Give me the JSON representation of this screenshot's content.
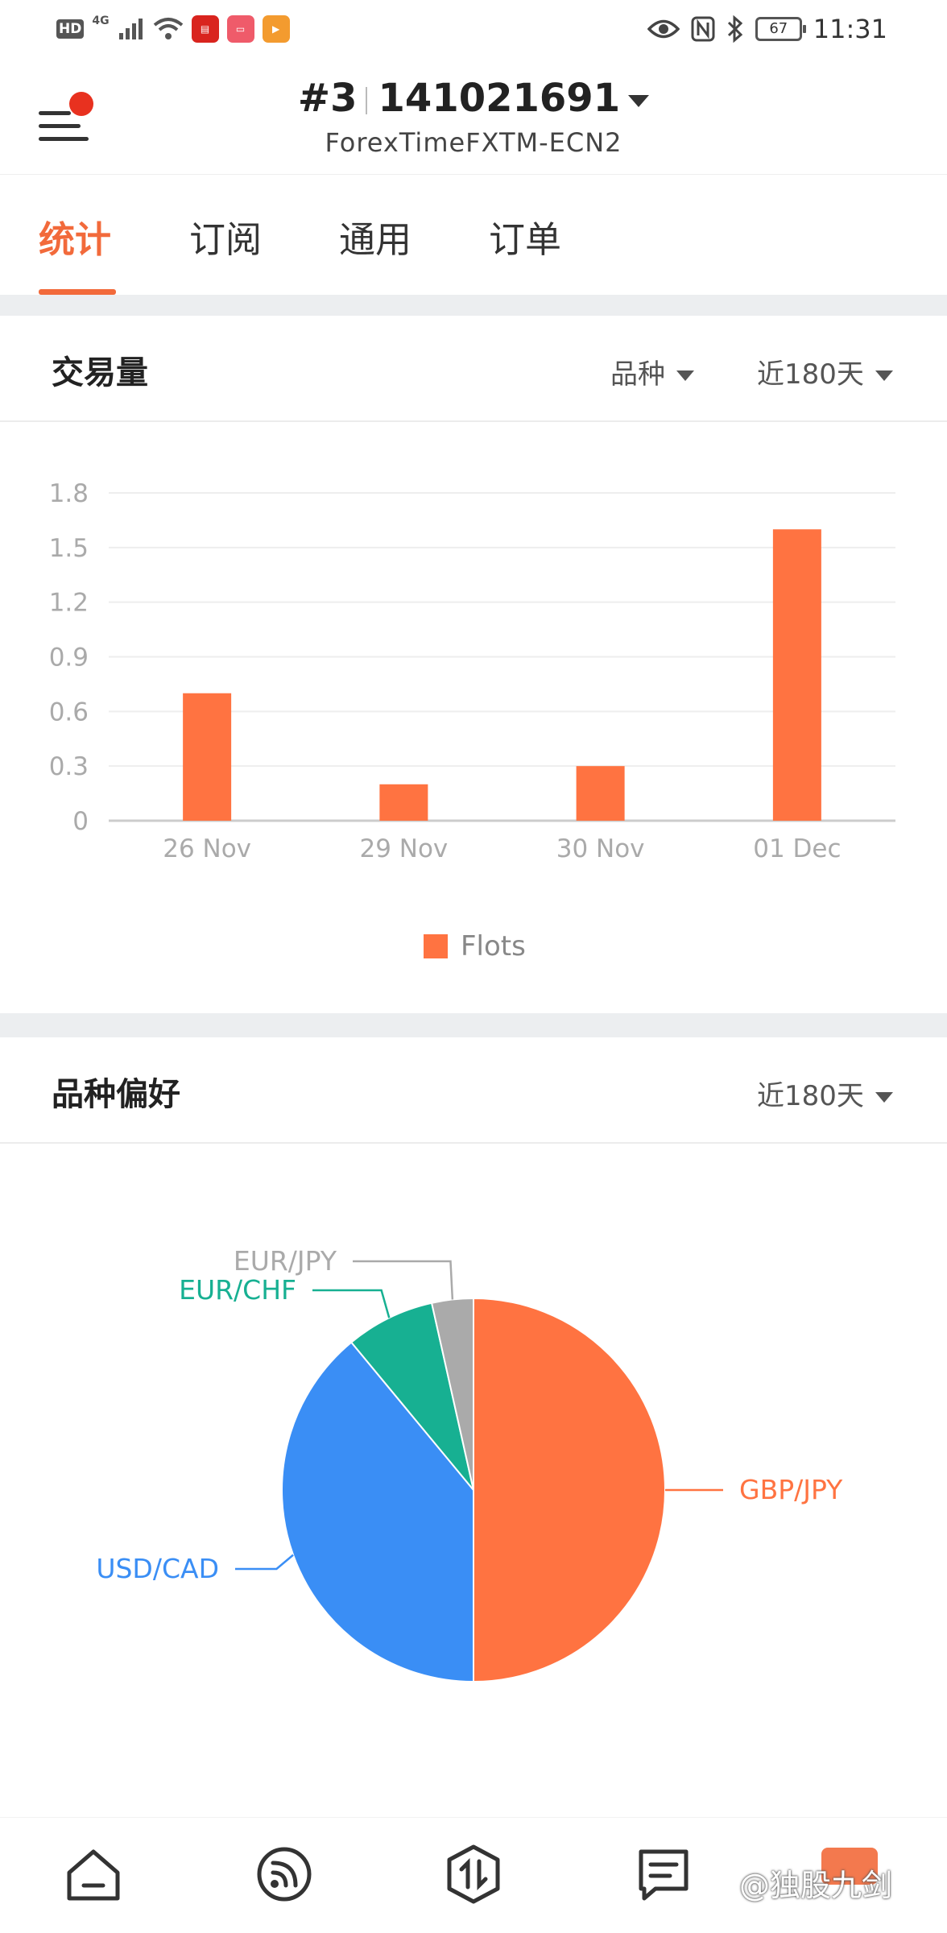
{
  "status_bar": {
    "hd": "HD",
    "network": "4G",
    "time": "11:31",
    "battery": "67"
  },
  "header": {
    "account_index": "#3",
    "account_number": "141021691",
    "server": "ForexTimeFXTM-ECN2"
  },
  "tabs": [
    "统计",
    "订阅",
    "通用",
    "订单"
  ],
  "volume_card": {
    "title": "交易量",
    "filter_symbol": "品种",
    "filter_period": "近180天"
  },
  "preference_card": {
    "title": "品种偏好",
    "filter_period": "近180天"
  },
  "accent_color": "#f26a3b",
  "chart_data": [
    {
      "type": "bar",
      "categories": [
        "26 Nov",
        "29 Nov",
        "30 Nov",
        "01 Dec"
      ],
      "series": [
        {
          "name": "Flots",
          "values": [
            0.7,
            0.2,
            0.3,
            1.6
          ],
          "color": "#ff7341"
        }
      ],
      "yticks": [
        "0",
        "0.3",
        "0.6",
        "0.9",
        "1.2",
        "1.5",
        "1.8"
      ],
      "ylim": [
        0,
        1.8
      ],
      "grid": true,
      "legend": "bottom"
    },
    {
      "type": "pie",
      "labels": [
        "GBP/JPY",
        "USD/CAD",
        "EUR/CHF",
        "EUR/JPY"
      ],
      "values": [
        50,
        39,
        7.5,
        3.5
      ],
      "colors": [
        "#ff7341",
        "#3a8ef5",
        "#17b092",
        "#aaaaaa"
      ]
    }
  ],
  "bottom_nav": {
    "icons": [
      "home-icon",
      "feed-icon",
      "trade-icon",
      "message-icon"
    ],
    "watermark": "@独股九剑"
  }
}
